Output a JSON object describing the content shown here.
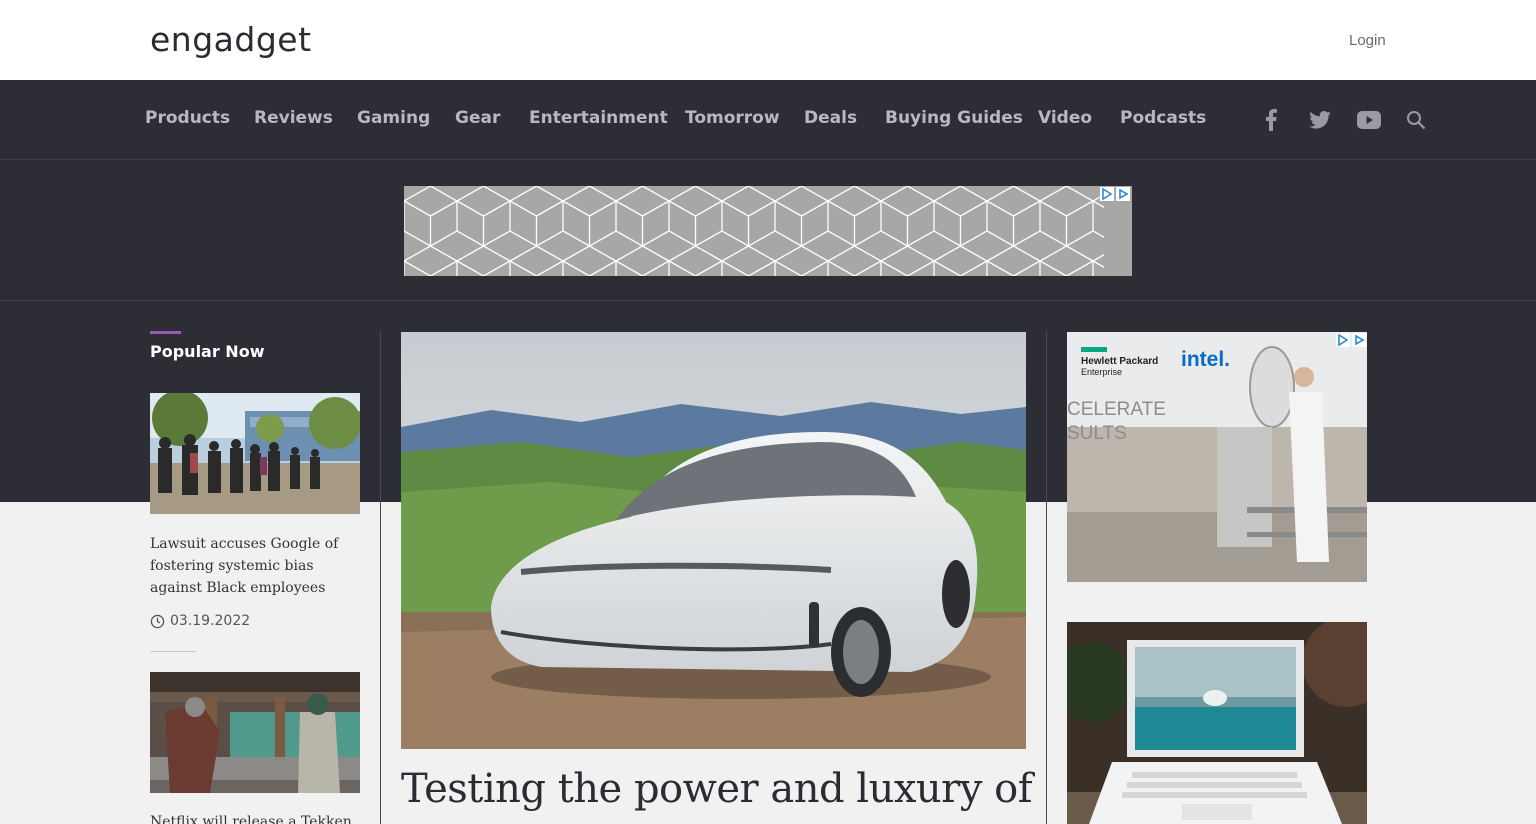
{
  "header": {
    "logo": "engadget",
    "login_label": "Login"
  },
  "nav": {
    "items": [
      "Products",
      "Reviews",
      "Gaming",
      "Gear",
      "Entertainment",
      "Tomorrow",
      "Deals",
      "Buying Guides",
      "Video",
      "Podcasts"
    ],
    "social_icons": [
      "facebook-icon",
      "twitter-icon",
      "youtube-icon",
      "search-icon"
    ]
  },
  "popular": {
    "heading": "Popular Now",
    "items": [
      {
        "headline": "Lawsuit accuses Google of fostering systemic bias against Black employees",
        "date": "03.19.2022"
      },
      {
        "headline": "Netflix will release a Tekken"
      }
    ]
  },
  "main": {
    "title": "Testing the power and luxury of"
  },
  "ads": {
    "sidebar_ad": {
      "brand_1": "Hewlett Packard",
      "brand_1b": "Enterprise",
      "brand_2": "intel.",
      "text_1": "CELERATE",
      "text_2": "SULTS"
    }
  },
  "colors": {
    "dark_band": "#2d2e35",
    "nav_text": "#b8b9bf",
    "accent_purple": "#9b59b6"
  }
}
